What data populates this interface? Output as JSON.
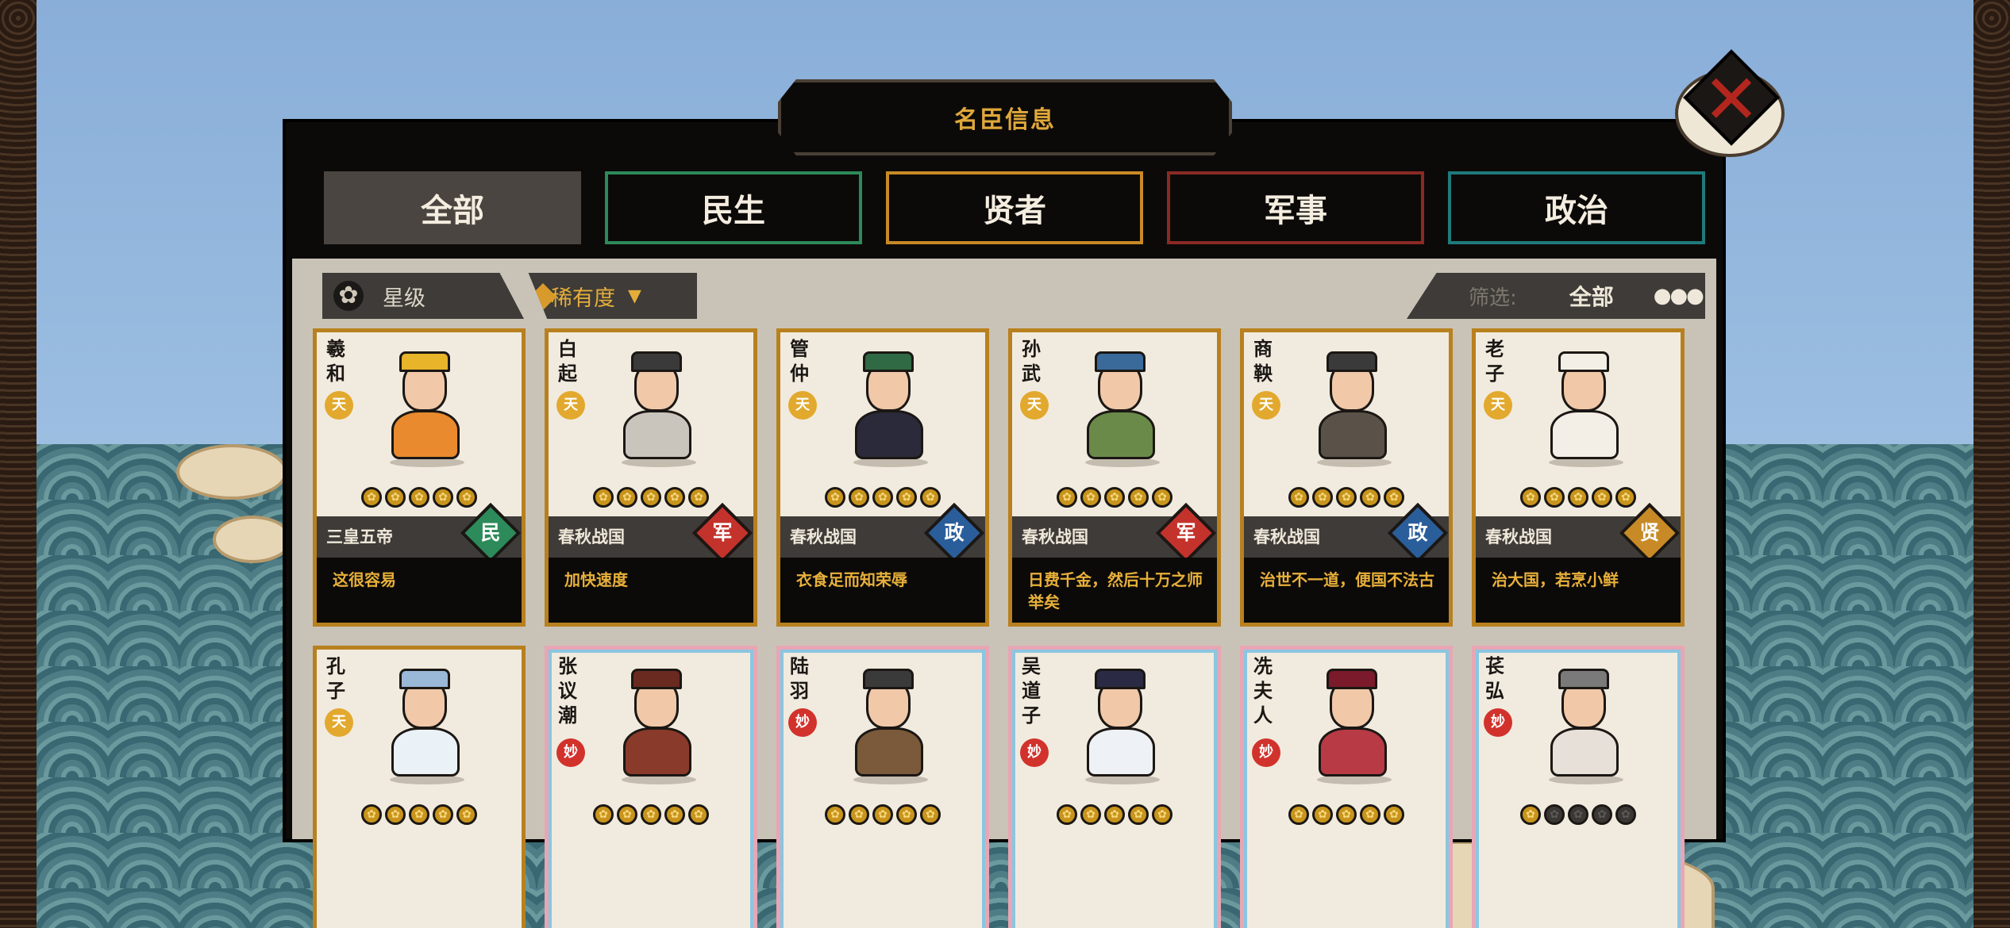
{
  "title": "名臣信息",
  "close_icon": "close-x-icon",
  "tabs": [
    {
      "label": "全部"
    },
    {
      "label": "民生"
    },
    {
      "label": "贤者"
    },
    {
      "label": "军事"
    },
    {
      "label": "政治"
    }
  ],
  "sort": {
    "star_label": "星级",
    "rarity_label": "稀有度"
  },
  "filter": {
    "label": "筛选:",
    "value": "全部"
  },
  "colors": {
    "accent": "#e0a83a",
    "min": "#2d8a5a",
    "xian": "#c88a26",
    "jun": "#c4322c",
    "zheng": "#2a5e9a"
  },
  "cards": [
    {
      "name": "羲和",
      "rarity": "天",
      "stars": 5,
      "era": "三皇五帝",
      "tag": "民",
      "quote": "这很容易"
    },
    {
      "name": "白起",
      "rarity": "天",
      "stars": 5,
      "era": "春秋战国",
      "tag": "军",
      "quote": "加快速度"
    },
    {
      "name": "管仲",
      "rarity": "天",
      "stars": 5,
      "era": "春秋战国",
      "tag": "政",
      "quote": "衣食足而知荣辱"
    },
    {
      "name": "孙武",
      "rarity": "天",
      "stars": 5,
      "era": "春秋战国",
      "tag": "军",
      "quote": "日费千金，然后十万之师举矣"
    },
    {
      "name": "商鞅",
      "rarity": "天",
      "stars": 5,
      "era": "春秋战国",
      "tag": "政",
      "quote": "治世不一道，便国不法古"
    },
    {
      "name": "老子",
      "rarity": "天",
      "stars": 5,
      "era": "春秋战国",
      "tag": "贤",
      "quote": "治大国，若烹小鲜"
    },
    {
      "name": "孔子",
      "rarity": "天",
      "stars": 5,
      "era": "",
      "tag": "",
      "quote": ""
    },
    {
      "name": "张议潮",
      "rarity": "妙",
      "stars": 5,
      "era": "",
      "tag": "",
      "quote": ""
    },
    {
      "name": "陆羽",
      "rarity": "妙",
      "stars": 5,
      "era": "",
      "tag": "",
      "quote": ""
    },
    {
      "name": "吴道子",
      "rarity": "妙",
      "stars": 5,
      "era": "",
      "tag": "",
      "quote": ""
    },
    {
      "name": "冼夫人",
      "rarity": "妙",
      "stars": 5,
      "era": "",
      "tag": "",
      "quote": ""
    },
    {
      "name": "苌弘",
      "rarity": "妙",
      "stars": 1,
      "era": "",
      "tag": "",
      "quote": ""
    }
  ]
}
